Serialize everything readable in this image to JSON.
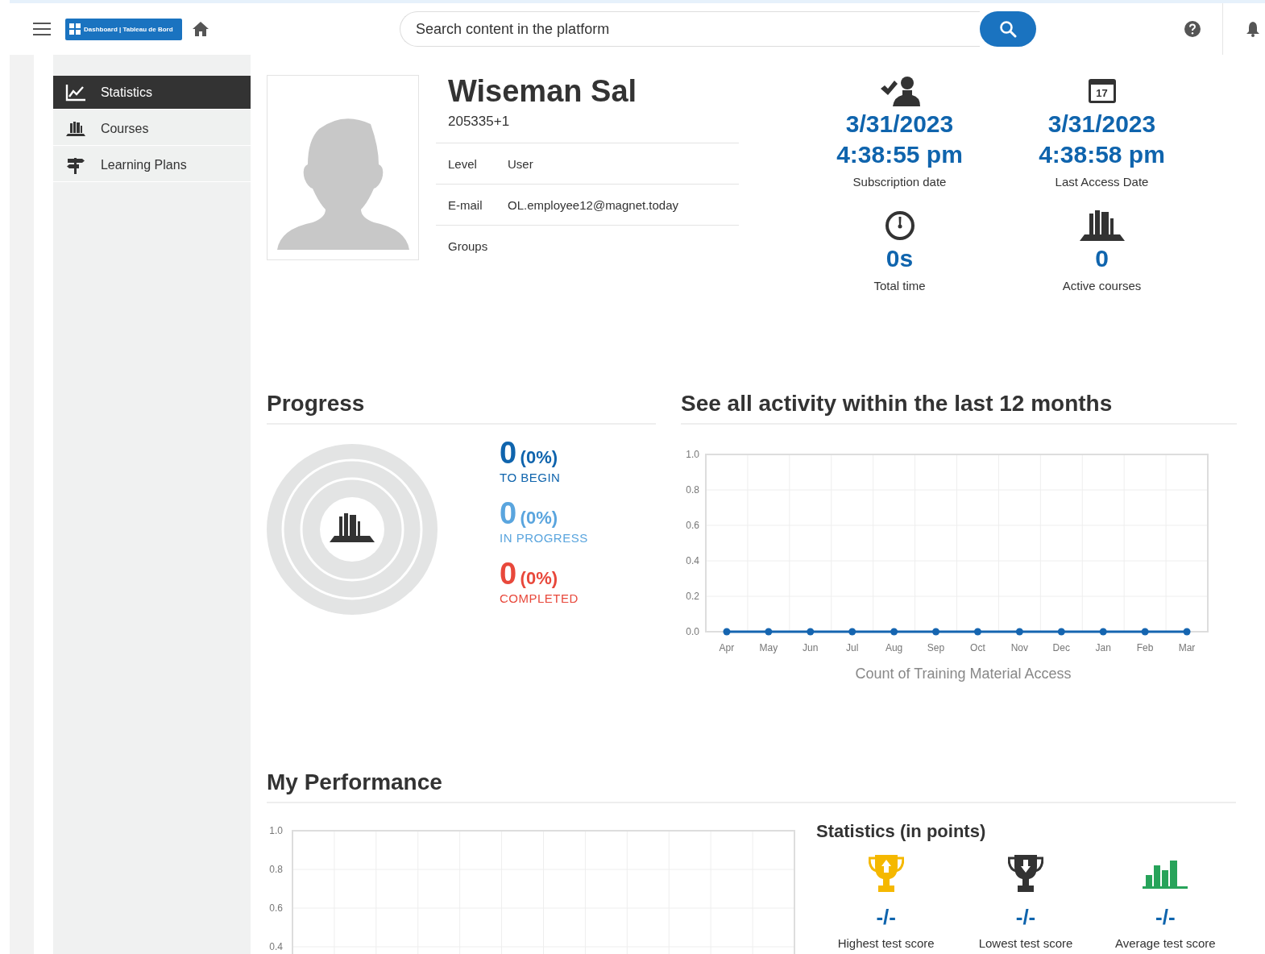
{
  "topbar": {
    "logo": "Dashboard | Tableau de Bord",
    "search": {
      "placeholder": "Search content in the platform"
    }
  },
  "sidebar": {
    "items": [
      {
        "label": "Statistics",
        "selected": true,
        "kind": "chart"
      },
      {
        "label": "Courses",
        "selected": false,
        "kind": "books"
      },
      {
        "label": "Learning Plans",
        "selected": false,
        "kind": "signpost"
      }
    ]
  },
  "profile": {
    "name": "Wiseman Sal",
    "id": "205335+1",
    "fields": [
      {
        "label": "Level",
        "value": "User"
      },
      {
        "label": "E-mail",
        "value": "OL.employee12@magnet.today"
      },
      {
        "label": "Groups"
      }
    ]
  },
  "summary": {
    "rows": [
      {
        "items": [
          {
            "kind": "subscription",
            "lines": [
              "3/31/2023",
              "4:38:55 pm"
            ],
            "label": "Subscription date"
          },
          {
            "kind": "calendar",
            "icon_text": "17",
            "lines": [
              "3/31/2023",
              "4:38:58 pm"
            ],
            "label": "Last Access Date"
          }
        ]
      },
      {
        "items": [
          {
            "kind": "time",
            "lines": [
              "0s"
            ],
            "label": "Total time"
          },
          {
            "kind": "courses",
            "lines": [
              "0"
            ],
            "label": "Active courses"
          }
        ]
      }
    ]
  },
  "progress": {
    "title": "Progress",
    "items": [
      {
        "count": "0",
        "percent": "(0%)",
        "label": "TO BEGIN",
        "color": "#0f64ad"
      },
      {
        "count": "0",
        "percent": "(0%)",
        "label": "IN PROGRESS",
        "color": "#5aa5de"
      },
      {
        "count": "0",
        "percent": "(0%)",
        "label": "COMPLETED",
        "color": "#e8483b"
      }
    ]
  },
  "activity": {
    "title": "See all activity within the last 12 months",
    "chart_data": {
      "type": "line",
      "xlabel": "Count of Training Material Access",
      "categories": [
        "Apr",
        "May",
        "Jun",
        "Jul",
        "Aug",
        "Sep",
        "Oct",
        "Nov",
        "Dec",
        "Jan",
        "Feb",
        "Mar"
      ],
      "grid": true,
      "series": [
        {
          "color": "#1565b0",
          "marker": "circle",
          "values": [
            0,
            0,
            0,
            0,
            0,
            0,
            0,
            0,
            0,
            0,
            0,
            0
          ]
        }
      ],
      "ylim": [
        0,
        1
      ],
      "yticks": [
        {
          "value": 0,
          "label": "0.0"
        },
        {
          "value": 0.2,
          "label": "0.2"
        },
        {
          "value": 0.4,
          "label": "0.4"
        },
        {
          "value": 0.6,
          "label": "0.6"
        },
        {
          "value": 0.8,
          "label": "0.8"
        },
        {
          "value": 1,
          "label": "1.0"
        }
      ]
    }
  },
  "performance": {
    "title": "My Performance",
    "chart_data": {
      "type": "line",
      "grid": true,
      "categories": [
        null,
        null,
        null,
        null,
        null,
        null,
        null,
        null,
        null,
        null,
        null,
        null
      ],
      "ylim": [
        0.35,
        1
      ],
      "yticks": [
        {
          "value": 0.4,
          "label": "0.4"
        },
        {
          "value": 0.6,
          "label": "0.6"
        },
        {
          "value": 0.8,
          "label": "0.8"
        },
        {
          "value": 1,
          "label": "1.0"
        }
      ]
    },
    "statistics": {
      "title": "Statistics (in points)",
      "items": [
        {
          "kind": "highest",
          "value": "-/-",
          "label": "Highest test score"
        },
        {
          "kind": "lowest",
          "value": "-/-",
          "label": "Lowest test score"
        },
        {
          "kind": "average",
          "value": "-/-",
          "label": "Average test score"
        }
      ]
    }
  }
}
